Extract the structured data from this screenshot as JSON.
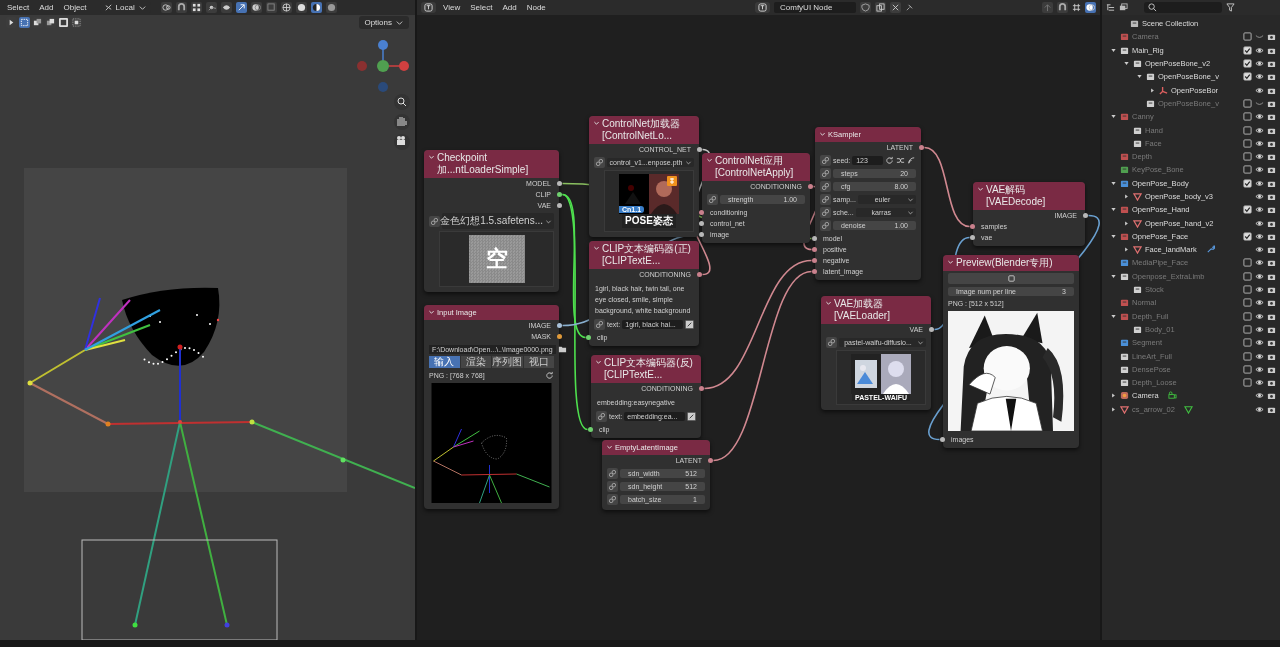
{
  "viewport_header": {
    "menus": [
      "Select",
      "Add",
      "Object"
    ],
    "orientation": "Local",
    "options_button": "Options"
  },
  "node_editor_header": {
    "menus": [
      "View",
      "Select",
      "Add",
      "Node"
    ],
    "node_tree_name": "ComfyUI Node"
  },
  "nodes": [
    {
      "title": "ControlNet加载器[ControlNetLo...",
      "outputs": [
        {
          "name": "CONTROL_NET",
          "color": "#b8b8b8"
        }
      ],
      "widgets": [
        {
          "kind": "dropdown",
          "value": "control_v1...enpose.pth"
        },
        {
          "kind": "thumbnail",
          "badge": "Cn1.1",
          "caption": "POSE姿态"
        }
      ]
    },
    {
      "title": "KSampler",
      "outputs": [
        {
          "name": "LATENT",
          "color": "#c9808c"
        }
      ],
      "widgets": [
        {
          "kind": "seed",
          "label": "seed:",
          "value": "123"
        },
        {
          "kind": "number",
          "label": "steps",
          "value": "20"
        },
        {
          "kind": "number",
          "label": "cfg",
          "value": "8.00"
        },
        {
          "kind": "select",
          "label": "samp...",
          "value": "euler"
        },
        {
          "kind": "select",
          "label": "sche...",
          "value": "karras"
        },
        {
          "kind": "number",
          "label": "denoise",
          "value": "1.00"
        }
      ],
      "inputs": [
        {
          "name": "model",
          "color": "#b8b8b8"
        },
        {
          "name": "positive",
          "color": "#c9808c"
        },
        {
          "name": "negative",
          "color": "#c9808c"
        },
        {
          "name": "latent_image",
          "color": "#c9808c"
        }
      ]
    },
    {
      "title": "Checkpoint加...ntLoaderSimple]",
      "outputs": [
        {
          "name": "MODEL",
          "color": "#b8b8b8"
        },
        {
          "name": "CLIP",
          "color": "#6fd06f"
        },
        {
          "name": "VAE",
          "color": "#b8b8b8"
        }
      ],
      "widgets": [
        {
          "kind": "dropdown",
          "value": "金色幻想1.5.safetens..."
        },
        {
          "kind": "thumbnail",
          "glyph": "空"
        }
      ]
    },
    {
      "title": "ControlNet应用[ControlNetApply]",
      "outputs": [
        {
          "name": "CONDITIONING",
          "color": "#c9808c"
        }
      ],
      "widgets": [
        {
          "kind": "number",
          "label": "strength",
          "value": "1.00"
        }
      ],
      "inputs": [
        {
          "name": "conditioning",
          "color": "#c9808c"
        },
        {
          "name": "control_net",
          "color": "#b8b8b8"
        },
        {
          "name": "image",
          "color": "#b8b8b8"
        }
      ]
    },
    {
      "title": "VAE解码[VAEDecode]",
      "outputs": [
        {
          "name": "IMAGE",
          "color": "#b8b8b8"
        }
      ],
      "inputs": [
        {
          "name": "samples",
          "color": "#c9808c"
        },
        {
          "name": "vae",
          "color": "#b8b8b8"
        }
      ]
    },
    {
      "title": "CLIP文本编码器(正)[CLIPTextE...",
      "outputs": [
        {
          "name": "CONDITIONING",
          "color": "#c9808c"
        }
      ],
      "widgets": [
        {
          "kind": "prompt",
          "value": "1girl, black hair, twin tail, one eye closed, smile, simple background, white background"
        },
        {
          "kind": "text_field",
          "label": "text:",
          "value": "1girl, black hai..."
        }
      ],
      "inputs": [
        {
          "name": "clip",
          "color": "#6fd06f"
        }
      ]
    },
    {
      "title": "VAE加载器[VAELoader]",
      "outputs": [
        {
          "name": "VAE",
          "color": "#b8b8b8"
        }
      ],
      "widgets": [
        {
          "kind": "dropdown",
          "value": "pastel-waifu-diffusio..."
        },
        {
          "kind": "thumbnail",
          "caption": "PASTEL-WAIFU"
        }
      ]
    },
    {
      "title": "Preview(Blender专用)",
      "widgets": [
        {
          "kind": "icon_button"
        },
        {
          "kind": "number_plain",
          "label": "Image num per line",
          "value": "3"
        },
        {
          "kind": "info",
          "value": "PNG : [512 x 512]"
        },
        {
          "kind": "picture"
        }
      ],
      "inputs": [
        {
          "name": "images",
          "color": "#b8b8b8"
        }
      ]
    },
    {
      "title": "Input Image",
      "outputs": [
        {
          "name": "IMAGE",
          "color": "#a8c0d8"
        },
        {
          "name": "MASK",
          "color": "#e09a3a"
        }
      ],
      "widgets": [
        {
          "kind": "file",
          "value": "F:\\Download\\Open...\\..\\Image0000.png"
        },
        {
          "kind": "tabs",
          "items": [
            {
              "label": "输入",
              "selected": true
            },
            {
              "label": "渲染",
              "selected": false
            },
            {
              "label": "序列图",
              "selected": false
            },
            {
              "label": "视口",
              "selected": false
            }
          ]
        },
        {
          "kind": "info_refresh",
          "value": "PNG : [768 x 768]"
        },
        {
          "kind": "pose_image"
        }
      ]
    },
    {
      "title": "CLIP文本编码器(反)[CLIPTextE...",
      "outputs": [
        {
          "name": "CONDITIONING",
          "color": "#c9808c"
        }
      ],
      "widgets": [
        {
          "kind": "prompt",
          "value": "embedding:easynegative"
        },
        {
          "kind": "text_field",
          "label": "text:",
          "value": "embedding:ea..."
        }
      ],
      "inputs": [
        {
          "name": "clip",
          "color": "#6fd06f"
        }
      ]
    },
    {
      "title": "EmptyLatentImage",
      "outputs": [
        {
          "name": "LATENT",
          "color": "#c9808c"
        }
      ],
      "widgets": [
        {
          "kind": "number",
          "label": "sdn_width",
          "value": "512"
        },
        {
          "kind": "number",
          "label": "sdn_height",
          "value": "512"
        },
        {
          "kind": "number",
          "label": "batch_size",
          "value": "1"
        }
      ]
    }
  ],
  "outliner": {
    "root": "Scene Collection",
    "items": [
      {
        "label": "Camera",
        "kind": "collection",
        "color": "#c05050",
        "checked": false,
        "active": false,
        "visible": false
      },
      {
        "label": "Main_Rig",
        "kind": "collection",
        "color": "#d0d0d0",
        "checked": true,
        "active": true,
        "visible": true,
        "expanded": true,
        "children": [
          {
            "label": "OpenPoseBone_v2",
            "kind": "collection",
            "color": "#d0d0d0",
            "checked": true,
            "active": true,
            "visible": true,
            "expanded": true,
            "children": [
              {
                "label": "OpenPoseBone_v",
                "kind": "collection",
                "color": "#d0d0d0",
                "checked": true,
                "active": true,
                "visible": true,
                "expanded": true,
                "children": [
                  {
                    "label": "OpenPoseBor",
                    "kind": "armature",
                    "active": true,
                    "visible": true,
                    "expanded": false
                  }
                ]
              },
              {
                "label": "OpenPoseBone_v",
                "kind": "collection",
                "color": "#d0d0d0",
                "checked": false,
                "active": false,
                "visible": false
              }
            ]
          }
        ]
      },
      {
        "label": "Canny",
        "kind": "collection",
        "color": "#c05050",
        "checked": false,
        "active": false,
        "visible": true,
        "expanded": true,
        "children": [
          {
            "label": "Hand",
            "kind": "collection",
            "color": "#d0d0d0",
            "checked": false,
            "active": false,
            "visible": true
          },
          {
            "label": "Face",
            "kind": "collection",
            "color": "#d0d0d0",
            "checked": false,
            "active": false,
            "visible": true
          }
        ]
      },
      {
        "label": "Depth",
        "kind": "collection",
        "color": "#c05050",
        "checked": false,
        "active": false,
        "visible": true
      },
      {
        "label": "KeyPose_Bone",
        "kind": "collection",
        "color": "#50a050",
        "checked": false,
        "active": false,
        "visible": true
      },
      {
        "label": "OpenPose_Body",
        "kind": "collection",
        "color": "#4a90d9",
        "checked": true,
        "active": true,
        "visible": true,
        "expanded": true,
        "children": [
          {
            "label": "OpenPose_body_v3",
            "kind": "mesh",
            "active": true,
            "visible": true,
            "expanded": false
          }
        ]
      },
      {
        "label": "OpenPose_Hand",
        "kind": "collection",
        "color": "#c05050",
        "checked": true,
        "active": true,
        "visible": true,
        "expanded": true,
        "children": [
          {
            "label": "OpenPose_hand_v2",
            "kind": "mesh",
            "active": true,
            "visible": true,
            "expanded": false
          }
        ]
      },
      {
        "label": "OpnePose_Face",
        "kind": "collection",
        "color": "#c05050",
        "checked": true,
        "active": true,
        "visible": true,
        "expanded": true,
        "children": [
          {
            "label": "Face_landMark",
            "kind": "mesh_with_modifier",
            "active": true,
            "visible": true,
            "expanded": false
          }
        ]
      },
      {
        "label": "MediaPipe_Face",
        "kind": "collection",
        "color": "#4a90d9",
        "checked": false,
        "active": false,
        "visible": true
      },
      {
        "label": "Openpose_ExtraLimb",
        "kind": "collection",
        "color": "#d0d0d0",
        "checked": false,
        "active": false,
        "visible": true,
        "expanded": true,
        "children": [
          {
            "label": "Stock",
            "kind": "collection",
            "color": "#d0d0d0",
            "checked": false,
            "active": false,
            "visible": true
          }
        ]
      },
      {
        "label": "Normal",
        "kind": "collection",
        "color": "#c05050",
        "checked": false,
        "active": false,
        "visible": true
      },
      {
        "label": "Depth_Full",
        "kind": "collection",
        "color": "#c05050",
        "checked": false,
        "active": false,
        "visible": true,
        "expanded": true,
        "children": [
          {
            "label": "Body_01",
            "kind": "collection",
            "color": "#d0d0d0",
            "checked": false,
            "active": false,
            "visible": true
          }
        ]
      },
      {
        "label": "Segment",
        "kind": "collection",
        "color": "#4a90d9",
        "checked": false,
        "active": false,
        "visible": true
      },
      {
        "label": "LineArt_Full",
        "kind": "collection",
        "color": "#d0d0d0",
        "checked": false,
        "active": false,
        "visible": true
      },
      {
        "label": "DensePose",
        "kind": "collection",
        "color": "#d0d0d0",
        "checked": false,
        "active": false,
        "visible": true
      },
      {
        "label": "Depth_Loose",
        "kind": "collection",
        "color": "#d0d0d0",
        "checked": false,
        "active": false,
        "visible": true
      },
      {
        "label": "Camera",
        "kind": "camera",
        "active": true,
        "visible": true,
        "expanded": false
      },
      {
        "label": "cs_arrow_02",
        "kind": "mesh_with_data",
        "active": false,
        "visible": true,
        "expanded": false
      }
    ]
  }
}
